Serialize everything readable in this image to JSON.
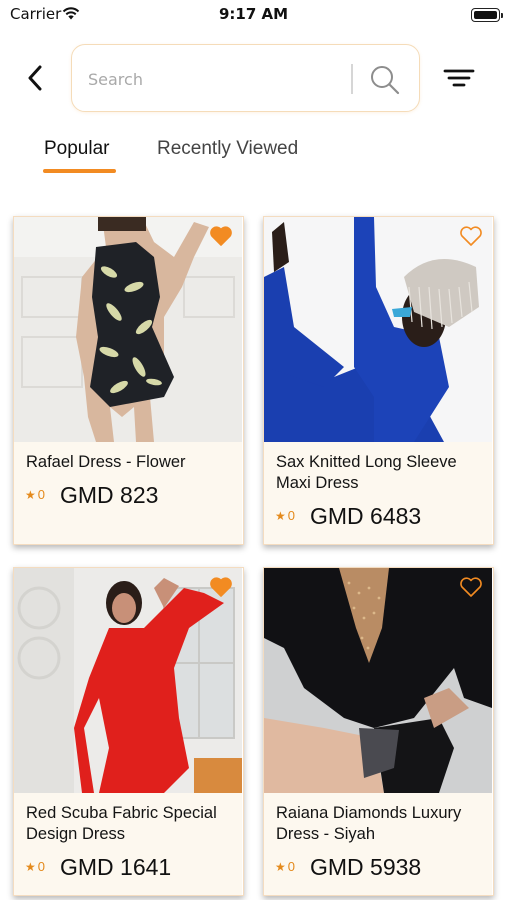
{
  "status_bar": {
    "carrier": "Carrier",
    "time": "9:17 AM"
  },
  "search": {
    "placeholder": "Search",
    "value": ""
  },
  "tabs": [
    {
      "label": "Popular",
      "active": true
    },
    {
      "label": "Recently Viewed",
      "active": false
    }
  ],
  "colors": {
    "accent": "#f28b22",
    "card_body": "#fdf8ef",
    "search_border": "#f5dcb9"
  },
  "products": [
    {
      "title": "Rafael Dress - Flower",
      "rating": "0",
      "price": "GMD 823",
      "favorited": true
    },
    {
      "title": "Sax Knitted Long Sleeve Maxi Dress",
      "rating": "0",
      "price": "GMD 6483",
      "favorited": false
    },
    {
      "title": "Red Scuba Fabric Special Design Dress",
      "rating": "0",
      "price": "GMD 1641",
      "favorited": true
    },
    {
      "title": "Raiana Diamonds Luxury Dress - Siyah",
      "rating": "0",
      "price": "GMD 5938",
      "favorited": false
    }
  ],
  "icons": {
    "back": "chevron-left-icon",
    "search": "search-icon",
    "filter": "filter-icon",
    "favorite": "heart-icon",
    "rating": "star-icon"
  }
}
